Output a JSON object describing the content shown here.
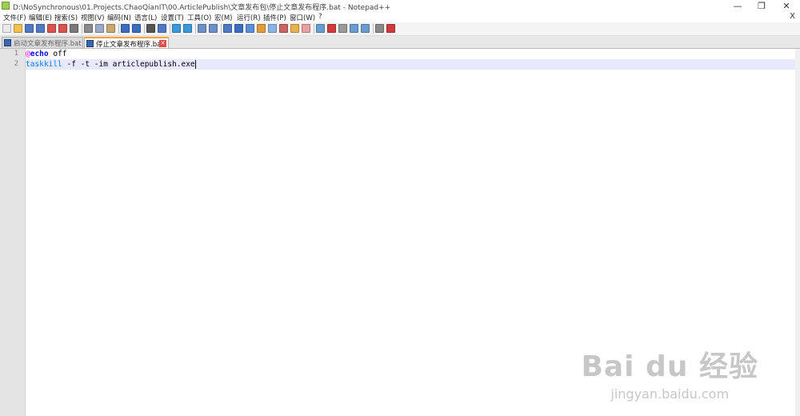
{
  "window": {
    "title": "D:\\NoSynchronous\\01.Projects.ChaoQianIT\\00.ArticlePublish\\文章发布包\\停止文章发布程序.bat - Notepad++",
    "minimize_glyph": "—",
    "maximize_glyph": "❐",
    "close_glyph": "✕"
  },
  "menu": {
    "items": [
      "文件(F)",
      "编辑(E)",
      "搜索(S)",
      "视图(V)",
      "编码(N)",
      "语言(L)",
      "设置(T)",
      "工具(O)",
      "宏(M)",
      "运行(R)",
      "插件(P)",
      "窗口(W)",
      "?"
    ],
    "close_label": "X"
  },
  "toolbar": {
    "icons": [
      "new-file-icon",
      "open-file-icon",
      "save-icon",
      "save-all-icon",
      "close-icon",
      "close-all-icon",
      "print-icon",
      "cut-icon",
      "copy-icon",
      "paste-icon",
      "undo-icon",
      "redo-icon",
      "find-icon",
      "replace-icon",
      "zoom-in-icon",
      "zoom-out-icon",
      "sync-vertical-icon",
      "sync-horizontal-icon",
      "word-wrap-icon",
      "show-all-chars-icon",
      "indent-guide-icon",
      "user-language-icon",
      "document-map-icon",
      "function-list-icon",
      "folder-workspace-icon",
      "monitor-icon",
      "record-macro-icon",
      "stop-record-icon",
      "play-macro-icon",
      "run-macro-multiple-icon",
      "save-macro-icon",
      "spell-check-icon",
      "plugin-icon"
    ]
  },
  "tabs": [
    {
      "label": "启动文章发布程序.bat",
      "active": false
    },
    {
      "label": "停止文章发布程序.bat",
      "active": true
    }
  ],
  "editor": {
    "line_numbers": [
      "1",
      "2"
    ],
    "line1": {
      "at": "@",
      "keyword": "echo",
      "rest": " off"
    },
    "line2": {
      "command": "taskkill",
      "rest": " -f -t -im articlepublish.exe"
    }
  },
  "watermark": {
    "logo": "Bai du 经验",
    "url": "jingyan.baidu.com"
  },
  "colors": {
    "current_line": "#e8e8ff",
    "keyword": "#0000ff",
    "command": "#0080ff",
    "at_sign": "#ff00ff",
    "active_tab_accent": "#f7a23b"
  }
}
